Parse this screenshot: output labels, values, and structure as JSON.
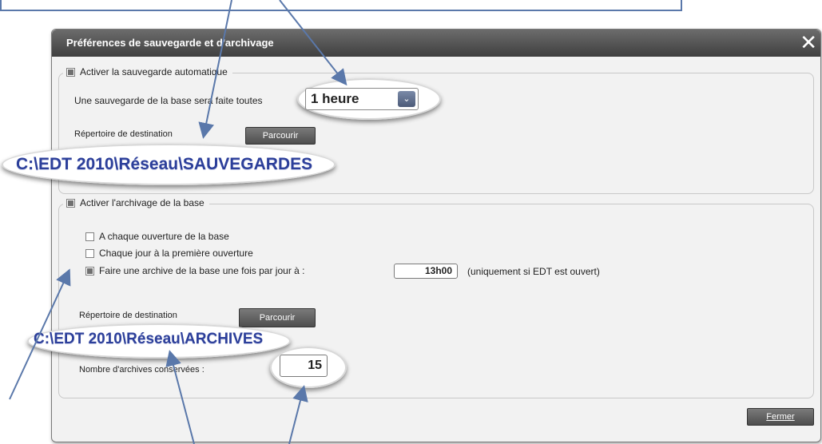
{
  "dialog": {
    "title": "Préférences de sauvegarde et d'archivage",
    "close_glyph": "✕"
  },
  "auto_save": {
    "checkbox_label": "Activer la sauvegarde automatique",
    "checked": true,
    "interval_label": "Une sauvegarde de la base sera faite toutes",
    "interval_value": "1 heure",
    "dest_label": "Répertoire de destination",
    "browse_label": "Parcourir",
    "path": "C:\\EDT 2010\\Réseau\\SAUVEGARDES"
  },
  "archive": {
    "checkbox_label": "Activer l'archivage de la base",
    "checked": true,
    "options": [
      {
        "label": "A chaque ouverture de la base",
        "checked": false
      },
      {
        "label": "Chaque jour à la première ouverture",
        "checked": false
      },
      {
        "label": "Faire une archive de la base une fois par jour à :",
        "checked": true
      }
    ],
    "time_value": "13h00",
    "time_note": "(uniquement si EDT est ouvert)",
    "dest_label": "Répertoire de destination",
    "browse_label": "Parcourir",
    "path": "C:\\EDT 2010\\Réseau\\ARCHIVES",
    "count_label": "Nombre d'archives conservées :",
    "count_value": "15"
  },
  "footer": {
    "close_label": "Fermer"
  },
  "colors": {
    "accent": "#2c3f9a",
    "arrow": "#5a78aa",
    "titlebar": "#4f4f4f"
  }
}
